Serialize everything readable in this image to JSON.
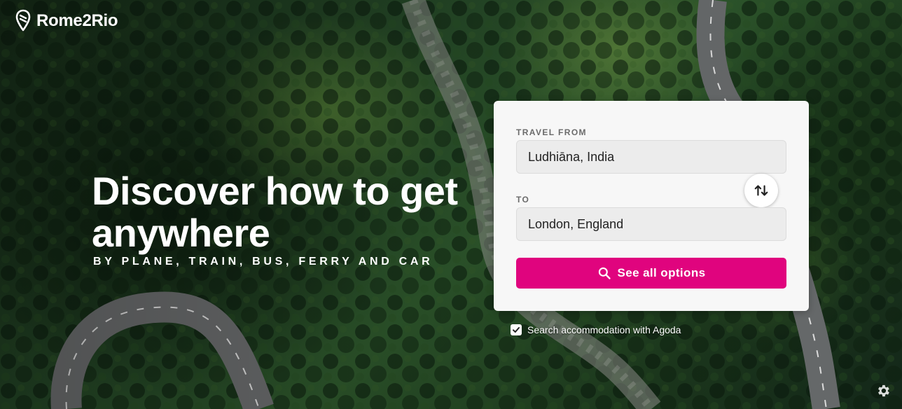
{
  "header": {
    "brand": "Rome2Rio",
    "logo_icon": "location-pin-icon"
  },
  "hero": {
    "title": "Discover how to get anywhere",
    "subtitle": "BY PLANE, TRAIN, BUS, FERRY AND CAR"
  },
  "search": {
    "from_label": "TRAVEL FROM",
    "from_value": "Ludhiāna, India",
    "to_label": "TO",
    "to_value": "London, England",
    "swap_icon": "swap-arrows-icon",
    "submit_label": "See all options",
    "submit_icon": "search-icon"
  },
  "accommodation": {
    "label": "Search accommodation with Agoda",
    "checked": true
  },
  "settings": {
    "icon": "gear-icon"
  },
  "colors": {
    "accent": "#e0047e",
    "card": "#f7f7f7",
    "field": "#ececec",
    "text_on_image": "#ffffff"
  }
}
